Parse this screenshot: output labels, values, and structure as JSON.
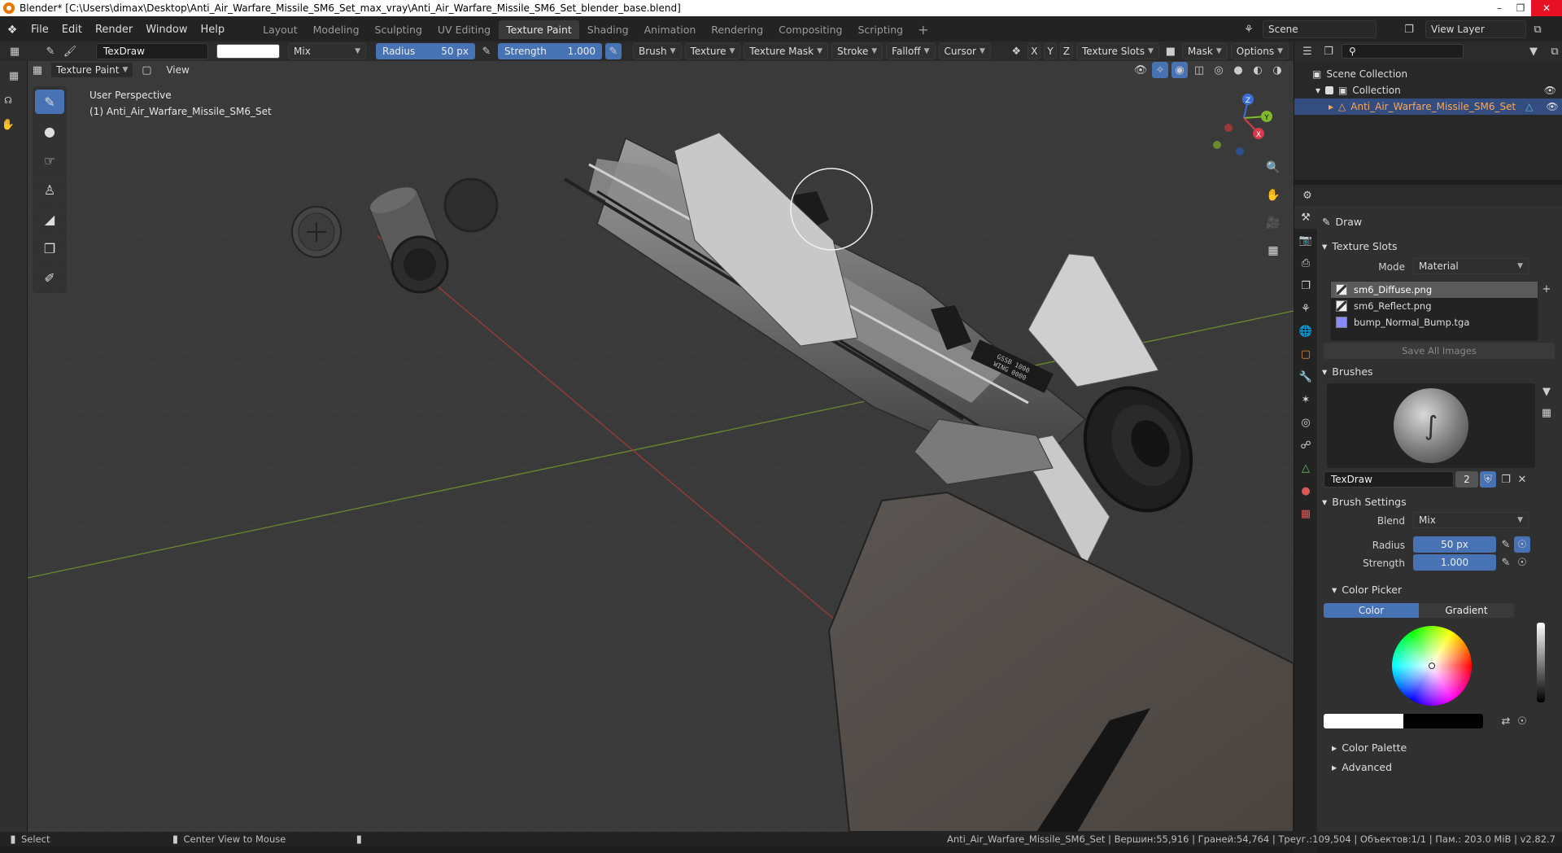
{
  "titlebar": {
    "title": "Blender* [C:\\Users\\dimax\\Desktop\\Anti_Air_Warfare_Missile_SM6_Set_max_vray\\Anti_Air_Warfare_Missile_SM6_Set_blender_base.blend]"
  },
  "menu": [
    "File",
    "Edit",
    "Render",
    "Window",
    "Help"
  ],
  "workspaces": [
    {
      "label": "Layout",
      "active": false
    },
    {
      "label": "Modeling",
      "active": false
    },
    {
      "label": "Sculpting",
      "active": false
    },
    {
      "label": "UV Editing",
      "active": false
    },
    {
      "label": "Texture Paint",
      "active": true
    },
    {
      "label": "Shading",
      "active": false
    },
    {
      "label": "Animation",
      "active": false
    },
    {
      "label": "Rendering",
      "active": false
    },
    {
      "label": "Compositing",
      "active": false
    },
    {
      "label": "Scripting",
      "active": false
    }
  ],
  "scene": {
    "name": "Scene",
    "view_layer": "View Layer"
  },
  "tool_header": {
    "brush_name": "TexDraw",
    "blend": "Mix",
    "radius_label": "Radius",
    "radius_value": "50 px",
    "strength_label": "Strength",
    "strength_value": "1.000",
    "menus": [
      "Brush",
      "Texture",
      "Texture Mask",
      "Stroke",
      "Falloff",
      "Cursor"
    ],
    "axes": [
      "X",
      "Y",
      "Z"
    ],
    "texture_slots": "Texture Slots",
    "mask": "Mask",
    "options": "Options"
  },
  "viewport_header": {
    "mode": "Texture Paint",
    "view": "View"
  },
  "viewport": {
    "perspective": "User Perspective",
    "object": "(1) Anti_Air_Warfare_Missile_SM6_Set",
    "label_line1": "GSSB 1000",
    "label_line2": "WING 0000"
  },
  "gizmo": {
    "x": "X",
    "y": "Y",
    "z": "Z"
  },
  "outliner": {
    "scene_collection": "Scene Collection",
    "collection": "Collection",
    "object": "Anti_Air_Warfare_Missile_SM6_Set"
  },
  "properties": {
    "tool_name": "Draw",
    "texture_slots_header": "Texture Slots",
    "mode_label": "Mode",
    "mode_value": "Material",
    "slots": [
      "sm6_Diffuse.png",
      "sm6_Reflect.png",
      "bump_Normal_Bump.tga"
    ],
    "save_all": "Save All Images",
    "brushes_header": "Brushes",
    "brush_name": "TexDraw",
    "brush_users": "2",
    "brush_settings_header": "Brush Settings",
    "blend_label": "Blend",
    "blend_value": "Mix",
    "radius_label": "Radius",
    "radius_value": "50 px",
    "strength_label": "Strength",
    "strength_value": "1.000",
    "color_picker_header": "Color Picker",
    "color_tab": "Color",
    "gradient_tab": "Gradient",
    "color_palette": "Color Palette",
    "advanced": "Advanced"
  },
  "statusbar": {
    "select": "Select",
    "center_view": "Center View to Mouse",
    "stats": "Anti_Air_Warfare_Missile_SM6_Set | Вершин:55,916 | Граней:54,764 | Треуг.:109,504 | Объектов:1/1 | Пам.: 203.0 MiB | v2.82.7"
  },
  "colors": {
    "accent_blue": "#4772b3",
    "selected_orange": "#ffa64d",
    "viewport_bg": "#393939"
  }
}
